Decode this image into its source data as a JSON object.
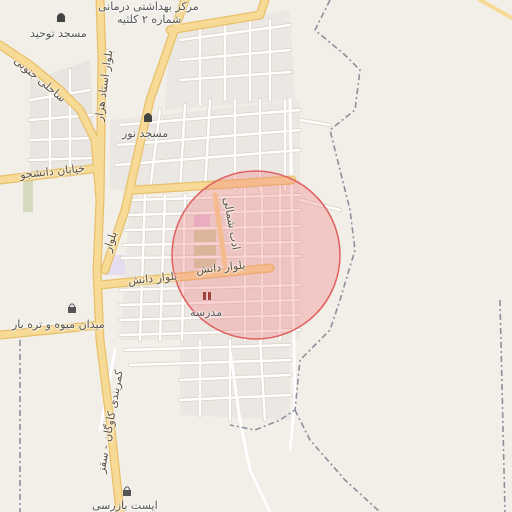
{
  "map": {
    "colors": {
      "background": "#f2efe9",
      "major_road": "#f7da96",
      "major_road_casing": "#e8c06a",
      "minor_road": "#ffffff",
      "minor_road_casing": "#d8d2c6",
      "boundary": "#8f8f9a",
      "radius_fill": "#f08080",
      "radius_stroke": "#e06060"
    },
    "radius_fill_opacity": 0.35,
    "labels": {
      "health_center_1": "مرکز بهداشتی درمانی",
      "health_center_2": "شماره ۲ کلثیه",
      "mosque_tohid": "مسجد توحید",
      "mosque_noor": "مسجد نور",
      "blvd_ostad_hazar": "بلوار استاد هزار",
      "sahel_jonubi": "ساحلی جنوبی",
      "khiaban_daneshjoo": "خیابان دانشجو",
      "blvd_danesh_1": "بلوار دانش",
      "blvd_danesh_2": "بلوار دانش",
      "blvd_short": "بلوار",
      "adab_shomali": "ادب شمالی",
      "school": "مدرسه",
      "fruit_market": "میدان میوه و تره بار",
      "kamarbandi": "کمربندی کاوگان - سقز",
      "bottom_label": "ایست بازرسی"
    },
    "icons": [
      "mosque-icon",
      "mosque-icon",
      "school-icon",
      "shop-icon",
      "shop-icon"
    ]
  }
}
